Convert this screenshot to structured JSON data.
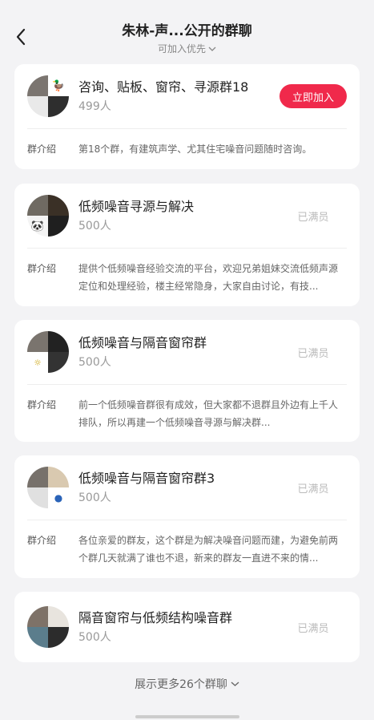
{
  "header": {
    "title": "朱林-声...公开的群聊",
    "subtitle": "可加入优先"
  },
  "groups": [
    {
      "name": "咨询、贴板、窗帘、寻源群18",
      "count": "499人",
      "action": "立即加入",
      "intro_label": "群介绍",
      "intro": "第18个群，有建筑声学、尤其住宅噪音问题随时咨询。"
    },
    {
      "name": "低频噪音寻源与解决",
      "count": "500人",
      "action": "已满员",
      "intro_label": "群介绍",
      "intro": "提供个低频噪音经验交流的平台，欢迎兄弟姐妹交流低频声源定位和处理经验，楼主经常隐身，大家自由讨论，有技..."
    },
    {
      "name": "低频噪音与隔音窗帘群",
      "count": "500人",
      "action": "已满员",
      "intro_label": "群介绍",
      "intro": "前一个低频噪音群很有成效，但大家都不退群且外边有上千人排队，所以再建一个低频噪音寻源与解决群..."
    },
    {
      "name": "低频噪音与隔音窗帘群3",
      "count": "500人",
      "action": "已满员",
      "intro_label": "群介绍",
      "intro": "各位亲爱的群友，这个群是为解决噪音问题而建，为避免前两个群几天就满了谁也不退，新来的群友一直进不来的情..."
    },
    {
      "name": "隔音窗帘与低频结构噪音群",
      "count": "500人",
      "action": "已满员"
    }
  ],
  "show_more": "展示更多26个群聊",
  "colors": {
    "accent": "#f0294b",
    "background": "#f3f3f5"
  }
}
